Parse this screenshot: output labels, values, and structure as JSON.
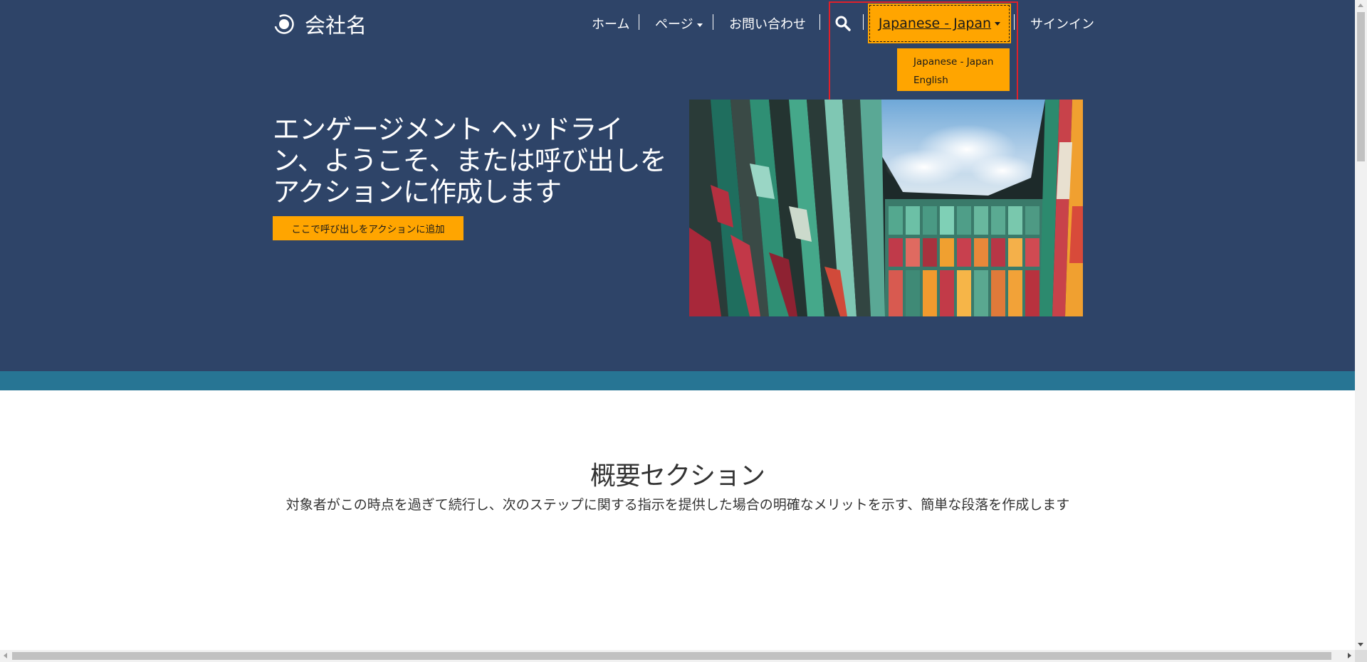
{
  "header": {
    "brand_name": "会社名",
    "nav": {
      "home": "ホーム",
      "pages": "ページ",
      "contact": "お問い合わせ",
      "sign_in": "サインイン"
    },
    "language": {
      "selected": "Japanese - Japan",
      "options": [
        "Japanese - Japan",
        "English"
      ]
    }
  },
  "hero": {
    "headline": "エンゲージメント ヘッドライン、ようこそ、または呼び出しをアクションに作成します",
    "cta_label": "ここで呼び出しをアクションに追加"
  },
  "overview": {
    "title": "概要セクション",
    "text": "対象者がこの時点を過ぎて続行し、次のステップに関する指示を提供した場合の明確なメリットを示す、簡単な段落を作成します"
  },
  "colors": {
    "hero_background": "#2e4468",
    "band": "#277594",
    "accent": "#ffa500",
    "highlight_border": "#e0202a"
  },
  "icons": {
    "brand": "brand-logo-icon",
    "search": "search-icon",
    "dropdown": "caret-down-icon"
  }
}
